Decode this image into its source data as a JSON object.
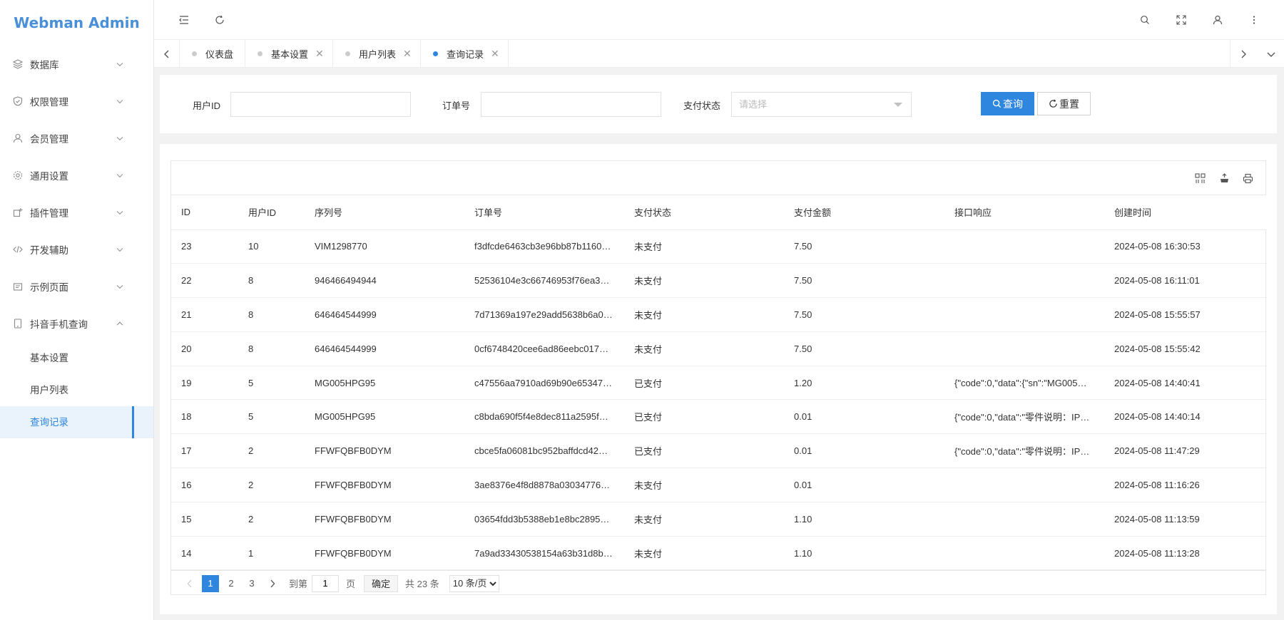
{
  "app": {
    "title": "Webman Admin"
  },
  "sidebar": {
    "items": [
      {
        "label": "数据库",
        "icon": "layers-icon"
      },
      {
        "label": "权限管理",
        "icon": "shield-icon"
      },
      {
        "label": "会员管理",
        "icon": "user-icon"
      },
      {
        "label": "通用设置",
        "icon": "gear-icon"
      },
      {
        "label": "插件管理",
        "icon": "plugin-icon"
      },
      {
        "label": "开发辅助",
        "icon": "code-icon"
      },
      {
        "label": "示例页面",
        "icon": "template-icon"
      },
      {
        "label": "抖音手机查询",
        "icon": "tablet-icon"
      }
    ],
    "sub_items": [
      {
        "label": "基本设置"
      },
      {
        "label": "用户列表"
      },
      {
        "label": "查询记录"
      }
    ]
  },
  "tabs": [
    {
      "label": "仪表盘"
    },
    {
      "label": "基本设置"
    },
    {
      "label": "用户列表"
    },
    {
      "label": "查询记录"
    }
  ],
  "filters": {
    "user_id_label": "用户ID",
    "order_no_label": "订单号",
    "pay_status_label": "支付状态",
    "pay_status_placeholder": "请选择",
    "query_button": "查询",
    "reset_button": "重置"
  },
  "table": {
    "columns": [
      "ID",
      "用户ID",
      "序列号",
      "订单号",
      "支付状态",
      "支付金额",
      "接口响应",
      "创建时间"
    ],
    "rows": [
      [
        "23",
        "10",
        "VIM1298770",
        "f3dfcde6463cb3e96bb87b1160…",
        "未支付",
        "7.50",
        "",
        "2024-05-08 16:30:53"
      ],
      [
        "22",
        "8",
        "946466494944",
        "52536104e3c66746953f76ea3…",
        "未支付",
        "7.50",
        "",
        "2024-05-08 16:11:01"
      ],
      [
        "21",
        "8",
        "646464544999",
        "7d71369a197e29add5638b6a0…",
        "未支付",
        "7.50",
        "",
        "2024-05-08 15:55:57"
      ],
      [
        "20",
        "8",
        "646464544999",
        "0cf6748420cee6ad86eebc017…",
        "未支付",
        "7.50",
        "",
        "2024-05-08 15:55:42"
      ],
      [
        "19",
        "5",
        "MG005HPG95",
        "c47556aa7910ad69b90e65347…",
        "已支付",
        "1.20",
        "{\"code\":0,\"data\":{\"sn\":\"MG005…",
        "2024-05-08 14:40:41"
      ],
      [
        "18",
        "5",
        "MG005HPG95",
        "c8bda690f5f4e8dec811a2595f…",
        "已支付",
        "0.01",
        "{\"code\":0,\"data\":\"零件说明：IP…",
        "2024-05-08 14:40:14"
      ],
      [
        "17",
        "2",
        "FFWFQBFB0DYM",
        "cbce5fa06081bc952baffdcd42…",
        "已支付",
        "0.01",
        "{\"code\":0,\"data\":\"零件说明：IP…",
        "2024-05-08 11:47:29"
      ],
      [
        "16",
        "2",
        "FFWFQBFB0DYM",
        "3ae8376e4f8d8878a03034776…",
        "未支付",
        "0.01",
        "",
        "2024-05-08 11:16:26"
      ],
      [
        "15",
        "2",
        "FFWFQBFB0DYM",
        "03654fdd3b5388eb1e8bc2895…",
        "未支付",
        "1.10",
        "",
        "2024-05-08 11:13:59"
      ],
      [
        "14",
        "1",
        "FFWFQBFB0DYM",
        "7a9ad33430538154a63b31d8b…",
        "未支付",
        "1.10",
        "",
        "2024-05-08 11:13:28"
      ]
    ]
  },
  "pager": {
    "pages": [
      "1",
      "2",
      "3"
    ],
    "goto_label": "到第",
    "goto_value": "1",
    "page_unit": "页",
    "confirm": "确定",
    "total": "共 23 条",
    "page_size": "10 条/页"
  },
  "colors": {
    "accent": "#2e86de",
    "logo": "#4a90d9"
  }
}
